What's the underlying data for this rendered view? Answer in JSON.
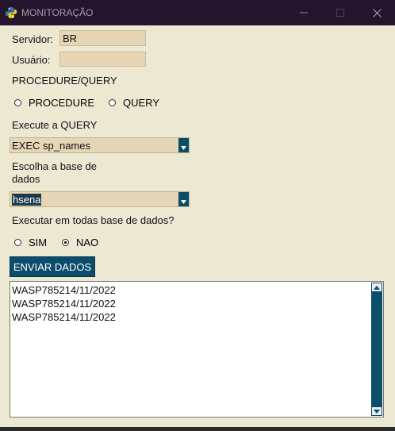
{
  "window": {
    "title": "MONITORAÇÃO",
    "icon": "python-icon",
    "controls": [
      "minimize-icon",
      "maximize-icon",
      "close-icon"
    ]
  },
  "form": {
    "servidor_label": "Servidor:",
    "servidor_value": "BR",
    "usuario_label": "Usuário:",
    "usuario_value": "",
    "proc_query_label": "PROCEDURE/QUERY",
    "radio_procedure": "PROCEDURE",
    "radio_query": "QUERY",
    "execute_label": "Execute a QUERY",
    "execute_value": "EXEC sp_names",
    "base_label_line1": "Escolha a base de",
    "base_label_line2": "dados",
    "base_value": "hsena",
    "all_db_label": "Executar em todas base de dados?",
    "radio_sim": "SIM",
    "radio_nao": "NAO",
    "selected_mode": "none",
    "selected_all_db": "NAO",
    "send_button": "ENVIAR DADOS"
  },
  "output": {
    "lines": [
      "WASP785214/11/2022",
      "WASP785214/11/2022",
      "WASP785214/11/2022"
    ]
  },
  "colors": {
    "titlebar": "#25142e",
    "background": "#ece8d2",
    "field": "#e7d6b6",
    "accent": "#0b4d6b"
  }
}
